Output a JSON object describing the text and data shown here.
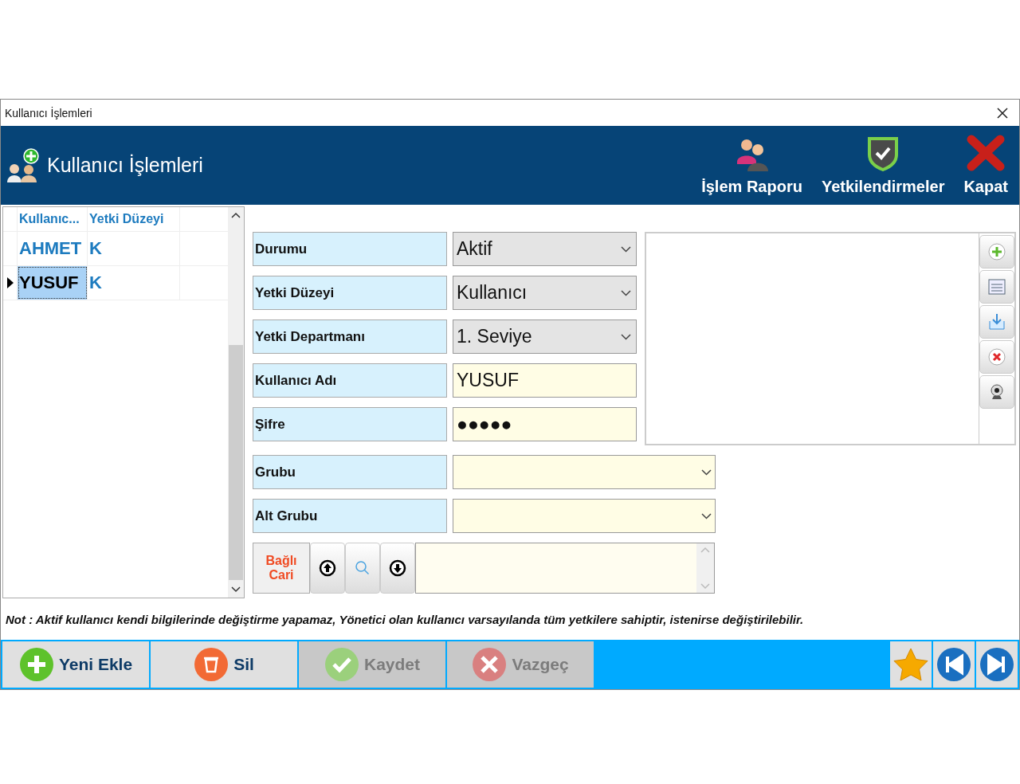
{
  "window": {
    "title": "Kullanıcı İşlemleri"
  },
  "header": {
    "title": "Kullanıcı İşlemleri",
    "actions": [
      {
        "label": "İşlem Raporu",
        "kind": "people"
      },
      {
        "label": "Yetkilendirmeler",
        "kind": "shield"
      },
      {
        "label": "Kapat",
        "kind": "close"
      }
    ]
  },
  "grid": {
    "columns": [
      "Kullanıc...",
      "Yetki Düzeyi"
    ],
    "rows": [
      {
        "cells": [
          "AHMET",
          "K"
        ],
        "selected": false
      },
      {
        "cells": [
          "YUSUF",
          "K"
        ],
        "selected": true
      }
    ]
  },
  "form": {
    "fields": [
      {
        "label": "Durumu",
        "kind": "select",
        "value": "Aktif"
      },
      {
        "label": "Yetki Düzeyi",
        "kind": "select",
        "value": "Kullanıcı"
      },
      {
        "label": "Yetki Departmanı",
        "kind": "select",
        "value": "1. Seviye"
      },
      {
        "label": "Kullanıcı Adı",
        "kind": "text",
        "value": "YUSUF"
      },
      {
        "label": "Şifre",
        "kind": "text",
        "value": "●●●●●"
      },
      {
        "label": "Grubu",
        "kind": "combo"
      },
      {
        "label": "Alt Grubu",
        "kind": "combo"
      }
    ],
    "linked": {
      "label": "Bağlı Cari"
    }
  },
  "photo_tools": [
    {
      "kind": "add"
    },
    {
      "kind": "card"
    },
    {
      "kind": "download"
    },
    {
      "kind": "delete"
    },
    {
      "kind": "camera"
    }
  ],
  "note": "**Not :** Aktif kullanıcı kendi bilgilerinde değiştirme yapamaz, Yönetici olan kullanıcı varsayılanda tüm yetkilere sahiptir, istenirse değiştirilebilir.",
  "bottom_buttons": [
    {
      "label": "Yeni Ekle",
      "kind": "add",
      "disabled": false
    },
    {
      "label": "Sil",
      "kind": "delete",
      "disabled": false
    },
    {
      "label": "Kaydet",
      "kind": "save",
      "disabled": true
    },
    {
      "label": "Vazgeç",
      "kind": "cancel",
      "disabled": true
    }
  ],
  "nav_buttons": [
    {
      "kind": "star"
    },
    {
      "kind": "first"
    },
    {
      "kind": "last"
    }
  ]
}
